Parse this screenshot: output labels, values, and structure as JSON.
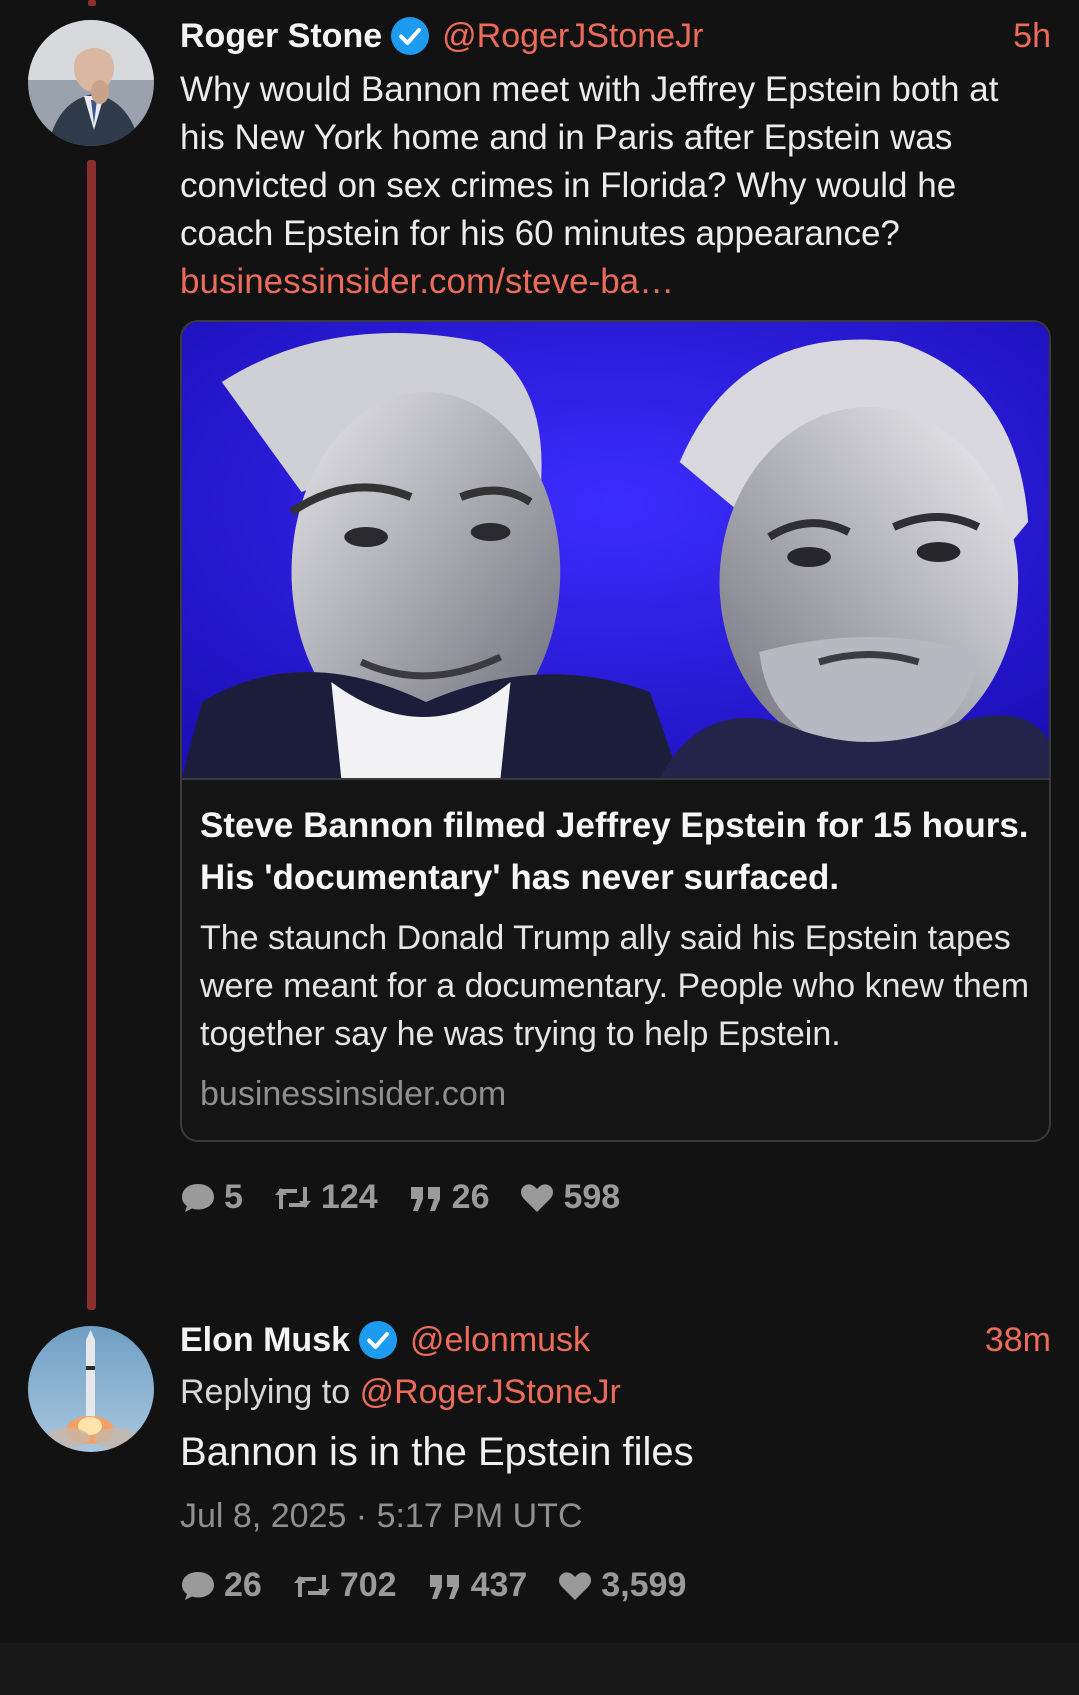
{
  "thread": {
    "tweets": [
      {
        "name": "Roger Stone",
        "handle": "@RogerJStoneJr",
        "time": "5h",
        "text": "Why would Bannon meet with Jeffrey Epstein both at his New York home and in Paris after Epstein was convicted on sex crimes in Florida? Why would he coach Epstein for his 60 minutes appearance?",
        "link": "businessinsider.com/steve-ba…",
        "card": {
          "title": "Steve Bannon filmed Jeffrey Epstein for 15 hours. His 'documentary' has never surfaced.",
          "description": "The staunch Donald Trump ally said his Epstein tapes were meant for a documentary. People who knew them together say he was trying to help Epstein.",
          "domain": "businessinsider.com"
        },
        "stats": {
          "replies": "5",
          "retweets": "124",
          "quotes": "26",
          "likes": "598"
        }
      },
      {
        "name": "Elon Musk",
        "handle": "@elonmusk",
        "time": "38m",
        "replying_label": "Replying to",
        "replying_to": "@RogerJStoneJr",
        "text": "Bannon is in the Epstein files",
        "date": "Jul 8, 2025 · 5:17 PM UTC",
        "stats": {
          "replies": "26",
          "retweets": "702",
          "quotes": "437",
          "likes": "3,599"
        }
      }
    ]
  },
  "colors": {
    "accent": "#ec6b5b",
    "thread_line": "#8a2e2e",
    "verified": "#1d9bf0",
    "background": "#121212"
  }
}
